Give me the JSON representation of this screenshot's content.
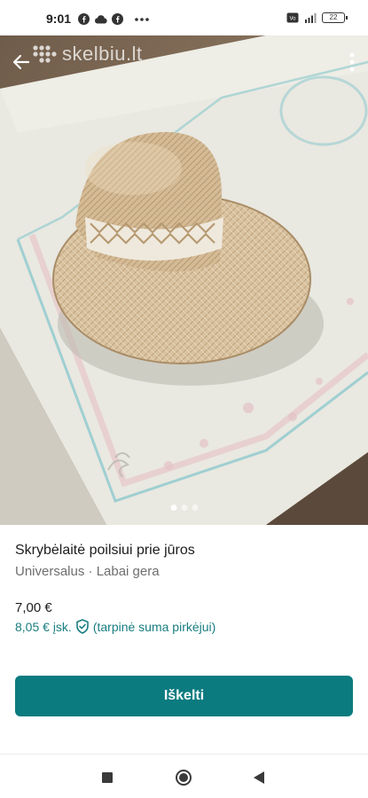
{
  "status_bar": {
    "time": "9:01",
    "left_icons": [
      "facebook-icon",
      "cloud-icon",
      "facebook-icon",
      "more-dots-icon"
    ],
    "right_icons": [
      "volte-icon",
      "signal-icon",
      "battery-icon"
    ],
    "battery_level": "22"
  },
  "photo": {
    "watermark": "skelbiu.lt",
    "pagination": {
      "total": 3,
      "active": 1
    }
  },
  "listing": {
    "title": "Skrybėlaitė poilsiui prie jūros",
    "subtitle": "Universalus · Labai gera",
    "price": "7,00 €",
    "price_incl": "8,05 € įsk.",
    "price_incl_note": "(tarpinė suma pirkėjui)"
  },
  "actions": {
    "primary_label": "Iškelti"
  },
  "colors": {
    "accent": "#0b7b80",
    "link": "#1a7d80"
  }
}
